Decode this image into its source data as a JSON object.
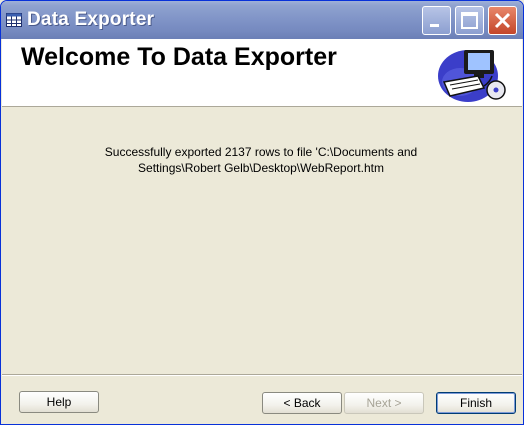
{
  "window": {
    "title": "Data Exporter",
    "icon": "table-grid-icon"
  },
  "titlebar_buttons": {
    "minimize_icon": "minimize-icon",
    "maximize_icon": "maximize-icon",
    "close_icon": "close-icon"
  },
  "header": {
    "title": "Welcome To Data Exporter",
    "art_icon": "computer-clipart-icon"
  },
  "main": {
    "message_line1": "Successfully exported 2137 rows to file 'C:\\Documents and",
    "message_line2": "Settings\\Robert Gelb\\Desktop\\WebReport.htm"
  },
  "footer": {
    "help_label": "Help",
    "back_label": "< Back",
    "next_label": "Next >",
    "finish_label": "Finish"
  },
  "colors": {
    "dialog_background": "#ece9d8",
    "titlebar": "#8195c8",
    "close_button": "#c4462a"
  }
}
